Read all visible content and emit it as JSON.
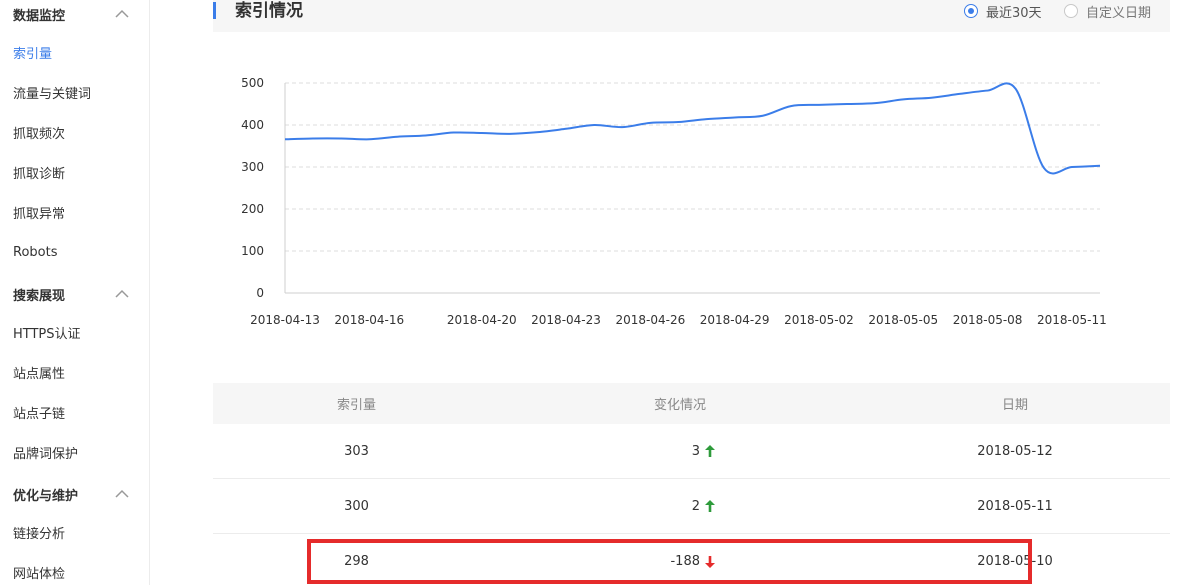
{
  "sidebar": {
    "groups": [
      {
        "label": "数据监控",
        "items": [
          "索引量",
          "流量与关键词",
          "抓取频次",
          "抓取诊断",
          "抓取异常",
          "Robots"
        ]
      },
      {
        "label": "搜索展现",
        "items": [
          "HTTPS认证",
          "站点属性",
          "站点子链",
          "品牌词保护"
        ]
      },
      {
        "label": "优化与维护",
        "items": [
          "链接分析",
          "网站体检"
        ]
      }
    ],
    "active_item": "索引量"
  },
  "header": {
    "title": "索引情况",
    "radio_recent": "最近30天",
    "radio_custom": "自定义日期"
  },
  "chart_data": {
    "type": "line",
    "x_ticks": [
      "2018-04-13",
      "2018-04-16",
      "2018-04-20",
      "2018-04-23",
      "2018-04-26",
      "2018-04-29",
      "2018-05-02",
      "2018-05-05",
      "2018-05-08",
      "2018-05-11"
    ],
    "y_ticks": [
      0,
      100,
      200,
      300,
      400,
      500
    ],
    "ylim": [
      0,
      500
    ],
    "series": [
      {
        "color": "#3b7de9",
        "x": [
          "2018-04-13",
          "2018-04-14",
          "2018-04-15",
          "2018-04-16",
          "2018-04-17",
          "2018-04-18",
          "2018-04-19",
          "2018-04-20",
          "2018-04-21",
          "2018-04-22",
          "2018-04-23",
          "2018-04-24",
          "2018-04-25",
          "2018-04-26",
          "2018-04-27",
          "2018-04-28",
          "2018-04-29",
          "2018-04-30",
          "2018-05-01",
          "2018-05-02",
          "2018-05-03",
          "2018-05-04",
          "2018-05-05",
          "2018-05-06",
          "2018-05-07",
          "2018-05-08",
          "2018-05-09",
          "2018-05-10",
          "2018-05-11",
          "2018-05-12"
        ],
        "values": [
          366,
          368,
          368,
          366,
          372,
          375,
          382,
          381,
          379,
          383,
          391,
          400,
          395,
          405,
          407,
          414,
          418,
          422,
          445,
          448,
          450,
          452,
          461,
          465,
          474,
          482,
          486,
          298,
          300,
          303
        ]
      }
    ],
    "grid": true
  },
  "table": {
    "headers": [
      "索引量",
      "变化情况",
      "日期"
    ],
    "rows": [
      {
        "count": "303",
        "delta": "3",
        "direction": "up",
        "date": "2018-05-12"
      },
      {
        "count": "300",
        "delta": "2",
        "direction": "up",
        "date": "2018-05-11"
      },
      {
        "count": "298",
        "delta": "-188",
        "direction": "down",
        "date": "2018-05-10"
      }
    ]
  },
  "colors": {
    "accent": "#3b7de9",
    "up": "#2e9b3b",
    "down": "#e52b2b",
    "highlight": "#e52b2b"
  }
}
